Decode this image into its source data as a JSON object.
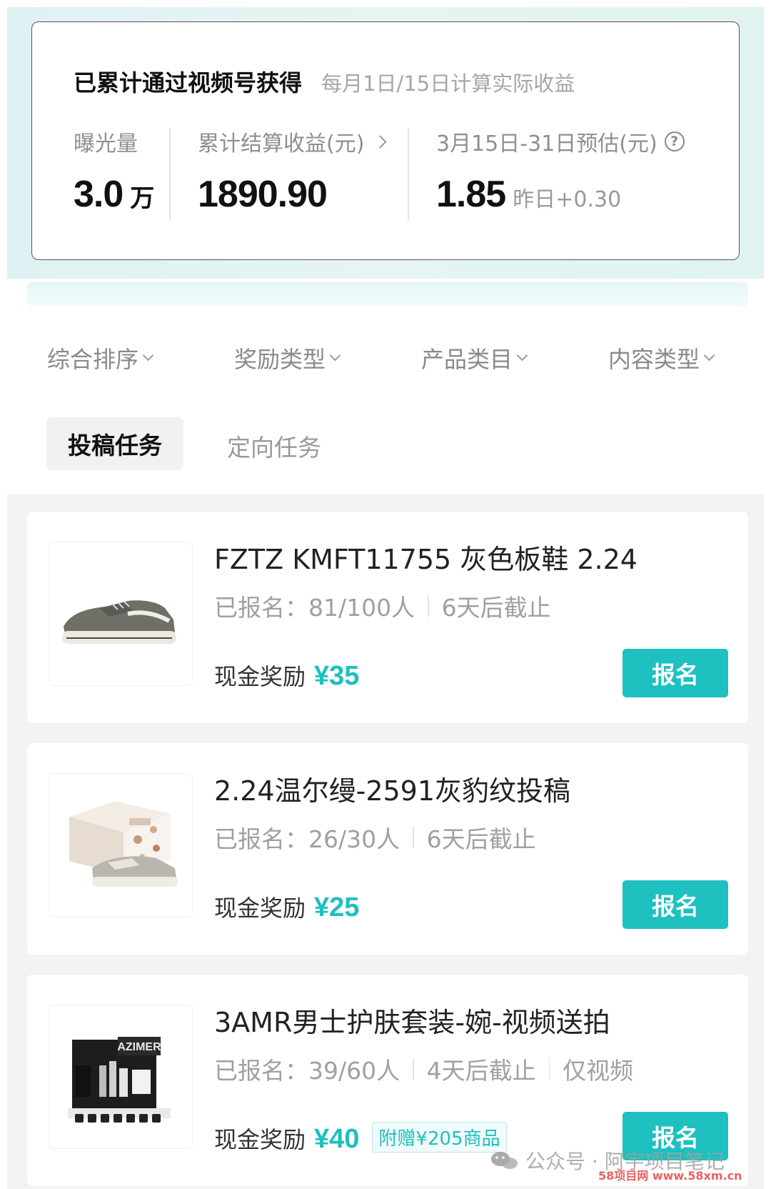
{
  "summary": {
    "title": "已累计通过视频号获得",
    "note": "每月1日/15日计算实际收益",
    "exposure": {
      "label": "曝光量",
      "value": "3.0",
      "unit": "万"
    },
    "earnings": {
      "label": "累计结算收益(元)",
      "value": "1890.90"
    },
    "estimate": {
      "label": "3月15日-31日预估(元)",
      "value": "1.85",
      "sub": "昨日+0.30"
    }
  },
  "filters": [
    "综合排序",
    "奖励类型",
    "产品类目",
    "内容类型"
  ],
  "tabs": {
    "active": "投稿任务",
    "inactive": "定向任务"
  },
  "tasks": [
    {
      "title": "FZTZ KMFT11755 灰色板鞋 2.24",
      "signed": "已报名：81/100人",
      "deadline": "6天后截止",
      "reward_label": "现金奖励",
      "reward_value": "¥35",
      "button": "报名",
      "image": "gray-sneaker"
    },
    {
      "title": "2.24温尔缦-2591灰豹纹投稿",
      "signed": "已报名：26/30人",
      "deadline": "6天后截止",
      "reward_label": "现金奖励",
      "reward_value": "¥25",
      "button": "报名",
      "image": "sneaker-with-box"
    },
    {
      "title": "3AMR男士护肤套装-婉-视频送拍",
      "signed": "已报名：39/60人",
      "deadline": "4天后截止",
      "extra": "仅视频",
      "reward_label": "现金奖励",
      "reward_value": "¥40",
      "gift": "附赠¥205商品",
      "button": "报名",
      "image": "skincare-set-azimer",
      "image_text": "AZIMER"
    }
  ],
  "watermark": {
    "text": "公众号 · 阿宇项目笔记",
    "site": "58项目网 www.58xm.cn"
  },
  "colors": {
    "accent": "#1ec0c0",
    "muted": "#999999"
  }
}
